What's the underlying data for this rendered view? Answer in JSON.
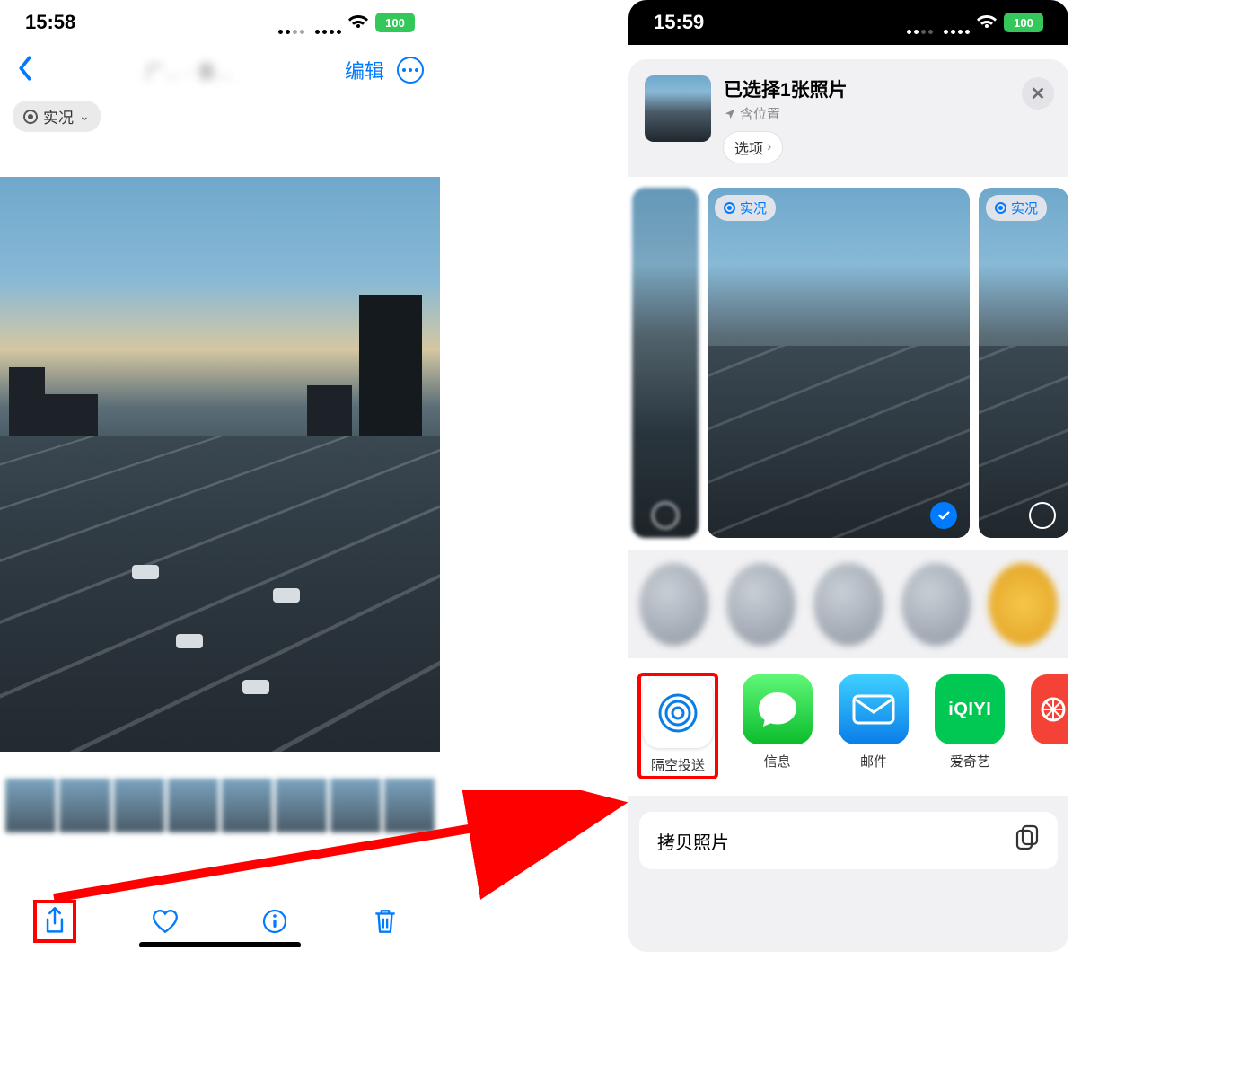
{
  "left": {
    "status": {
      "time": "15:58",
      "battery": "100"
    },
    "nav": {
      "edit_label": "编辑",
      "title_blurred": "广… · 香…"
    },
    "live_chip": "实况",
    "toolbar": {
      "share": "share",
      "favorite": "favorite",
      "info": "info",
      "delete": "delete"
    }
  },
  "right": {
    "status": {
      "time": "15:59",
      "battery": "100"
    },
    "sheet": {
      "title": "已选择1张照片",
      "subtitle": "含位置",
      "options_label": "选项",
      "live_badge": "实况",
      "apps": [
        {
          "id": "airdrop",
          "label": "隔空投送"
        },
        {
          "id": "messages",
          "label": "信息"
        },
        {
          "id": "mail",
          "label": "邮件"
        },
        {
          "id": "iqiyi",
          "label": "爱奇艺",
          "text": "iQIYI"
        },
        {
          "id": "red",
          "label": ""
        }
      ],
      "copy_photo": "拷贝照片"
    }
  }
}
